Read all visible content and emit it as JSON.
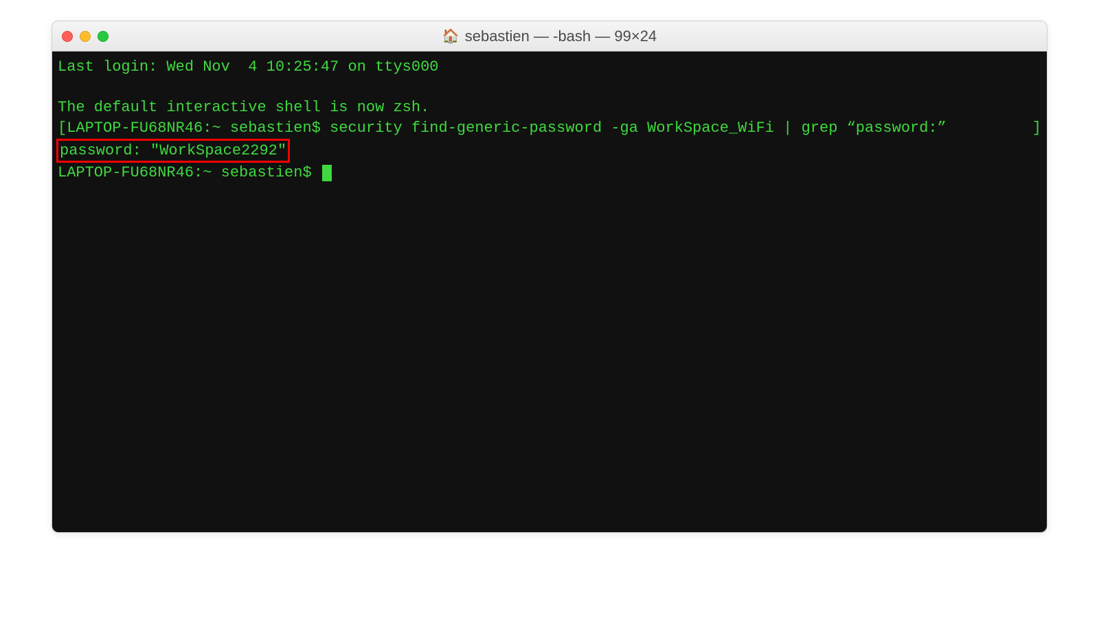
{
  "window": {
    "title": "sebastien — -bash — 99×24",
    "home_icon": "🏠"
  },
  "terminal": {
    "lines": {
      "last_login": "Last login: Wed Nov  4 10:25:47 on ttys000",
      "blank": " ",
      "zsh_notice": "The default interactive shell is now zsh.",
      "command_line_bracket_left": "[",
      "prompt1": "LAPTOP-FU68NR46:~ sebastien$ ",
      "command": "security find-generic-password -ga WorkSpace_WiFi | grep “password:”",
      "command_line_bracket_right": "]",
      "password_output": "password: \"WorkSpace2292\"",
      "prompt2": "LAPTOP-FU68NR46:~ sebastien$ "
    }
  }
}
